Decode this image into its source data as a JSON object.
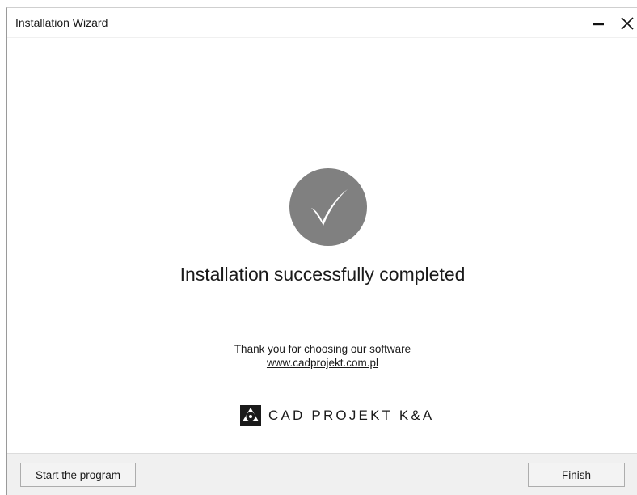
{
  "window": {
    "title": "Installation Wizard",
    "controls": {
      "minimize_icon": "minimize-icon",
      "close_icon": "close-icon"
    }
  },
  "main": {
    "status_icon": "checkmark-icon",
    "headline": "Installation successfully completed",
    "thanks": "Thank you for choosing our software",
    "website": "www.cadprojekt.com.pl",
    "logo": {
      "icon": "cad-projekt-logo-icon",
      "text": "CAD PROJEKT K&A"
    }
  },
  "footer": {
    "start_label": "Start the program",
    "finish_label": "Finish"
  },
  "colors": {
    "check_circle": "#808080",
    "footer_bg": "#f0f0f0",
    "button_border": "#adadad"
  }
}
